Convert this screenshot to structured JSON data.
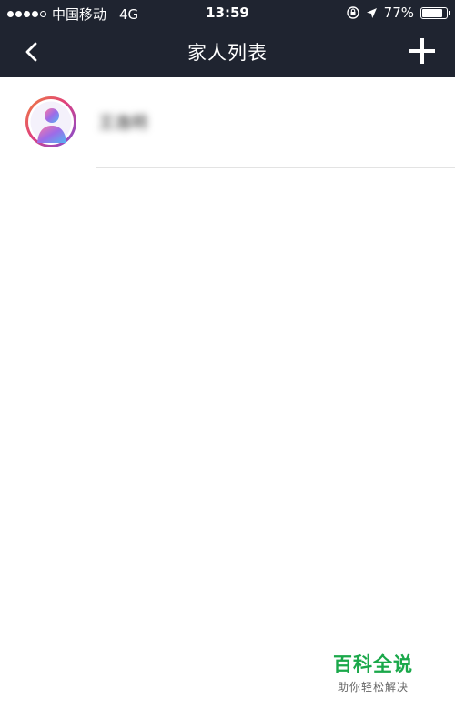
{
  "status_bar": {
    "carrier": "中国移动",
    "network": "4G",
    "time": "13:59",
    "battery": "77%",
    "battery_level": 0.77,
    "signal_bars": 4,
    "signal_bars_max": 5
  },
  "nav": {
    "title": "家人列表",
    "back_icon": "chevron-left-icon",
    "add_icon": "plus-icon"
  },
  "members": [
    {
      "name": "王逸明"
    }
  ],
  "watermark": {
    "title": "百科全说",
    "subtitle": "助你轻松解决"
  },
  "colors": {
    "header_bg": "#1f2430",
    "accent_green": "#1aa84a"
  }
}
